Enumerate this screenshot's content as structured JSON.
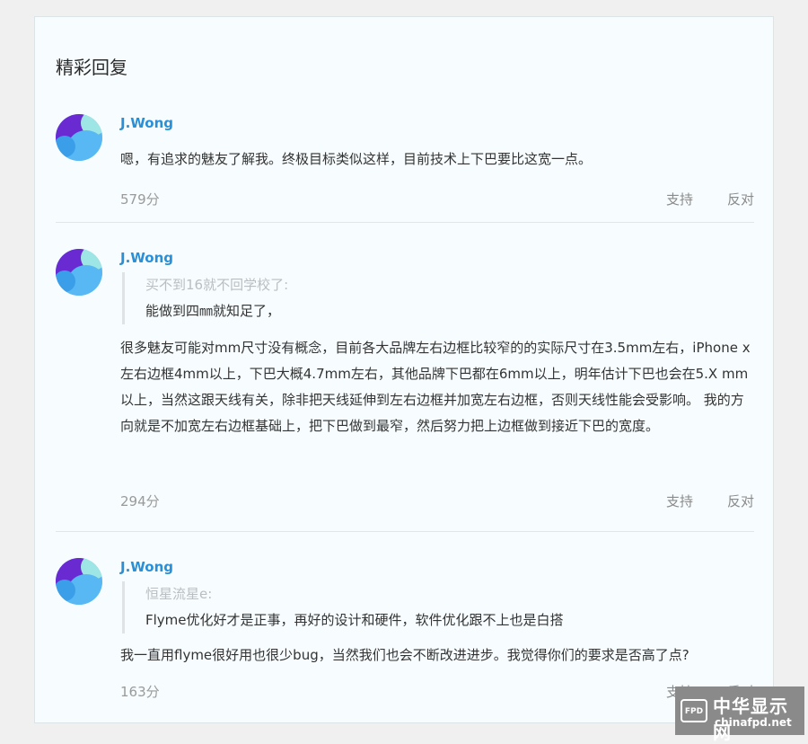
{
  "section_title": "精彩回复",
  "replies": [
    {
      "username": "J.Wong",
      "quote": null,
      "content": "嗯，有追求的魅友了解我。终极目标类似这样，目前技术上下巴要比这宽一点。",
      "score": "579分",
      "support": "支持",
      "oppose": "反对"
    },
    {
      "username": "J.Wong",
      "quote": {
        "author": "买不到16就不回学校了:",
        "text": "能做到四㎜就知足了，"
      },
      "content": "很多魅友可能对mm尺寸没有概念，目前各大品牌左右边框比较窄的的实际尺寸在3.5mm左右，iPhone x左右边框4mm以上，下巴大概4.7mm左右，其他品牌下巴都在6mm以上，明年估计下巴也会在5.X mm以上，当然这跟天线有关，除非把天线延伸到左右边框并加宽左右边框，否则天线性能会受影响。 我的方向就是不加宽左右边框基础上，把下巴做到最窄，然后努力把上边框做到接近下巴的宽度。",
      "score": "294分",
      "support": "支持",
      "oppose": "反对"
    },
    {
      "username": "J.Wong",
      "quote": {
        "author": "恒星流星e:",
        "text": "Flyme优化好才是正事，再好的设计和硬件，软件优化跟不上也是白搭"
      },
      "content": "我一直用flyme很好用也很少bug，当然我们也会不断改进进步。我觉得你们的要求是否高了点?",
      "score": "163分",
      "support": "支持",
      "oppose": "反对"
    }
  ],
  "watermark": {
    "logo_text": "FPD",
    "cn": "中华显示网",
    "en": "chinafpd.net"
  }
}
